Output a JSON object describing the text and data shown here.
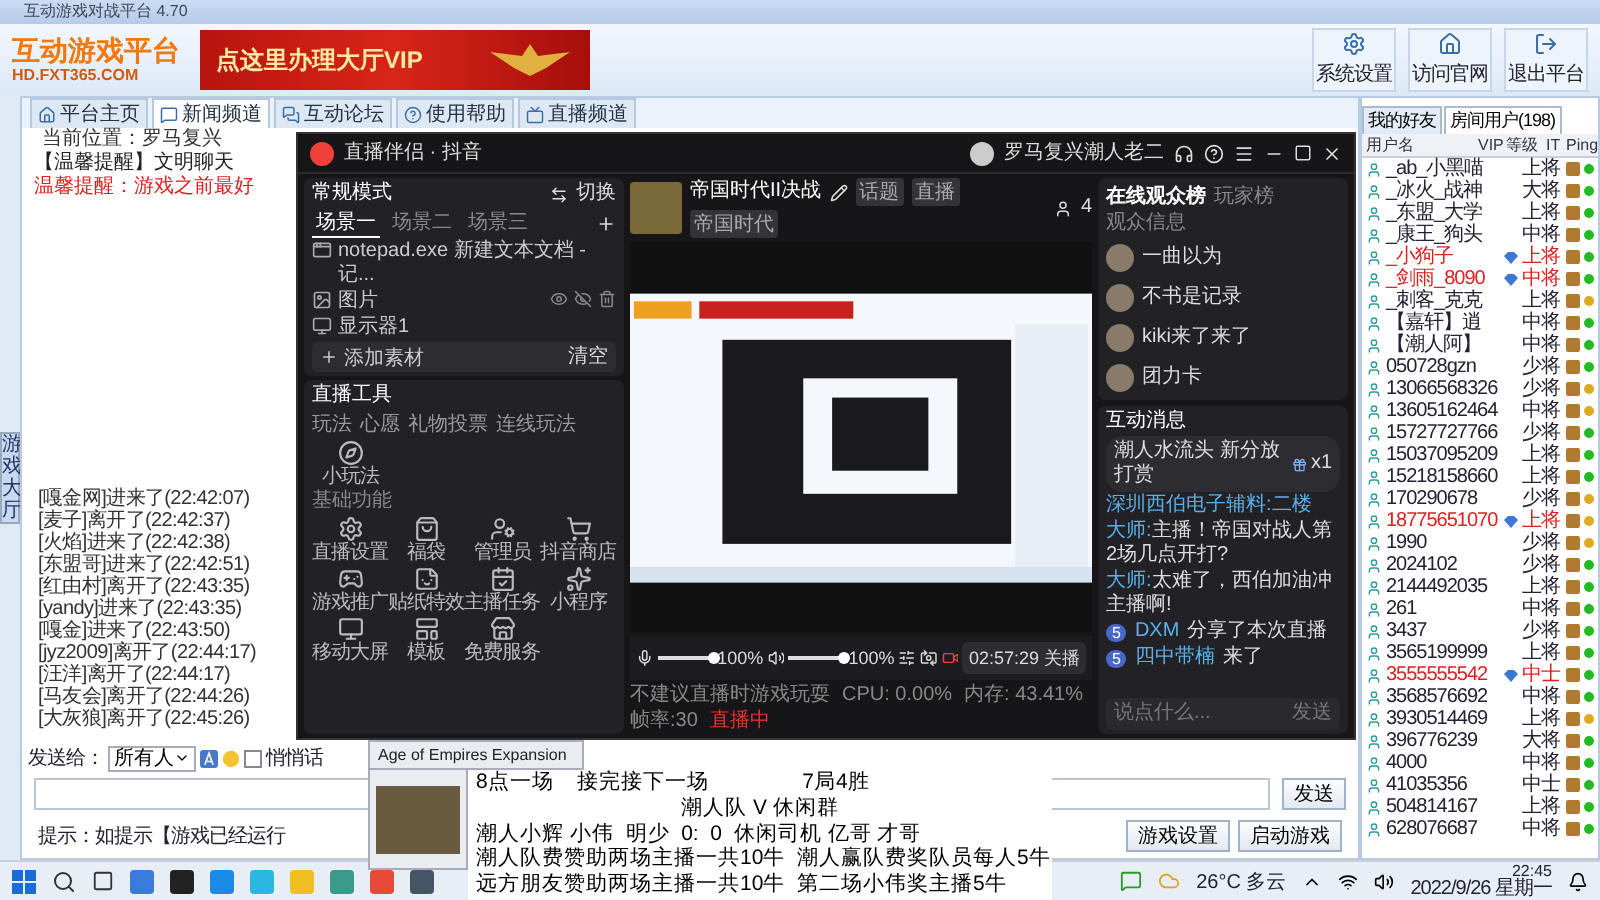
{
  "window": {
    "title": "互动游戏对战平台 4.70"
  },
  "header": {
    "logo_title": "互动游戏平台",
    "logo_url": "HD.FXT365.COM",
    "banner_text": "点这里办理大厅VIP",
    "buttons": [
      {
        "label": "系统设置"
      },
      {
        "label": "访问官网"
      },
      {
        "label": "退出平台"
      }
    ]
  },
  "nav_tabs": [
    {
      "label": "平台主页",
      "selected": false
    },
    {
      "label": "新闻频道",
      "selected": true
    },
    {
      "label": "互动论坛",
      "selected": false
    },
    {
      "label": "使用帮助",
      "selected": false
    },
    {
      "label": "直播频道",
      "selected": false
    }
  ],
  "side_tab": "游戏大厅",
  "breadcrumb": "当前位置：罗马复兴",
  "notices": [
    {
      "kind": "normal",
      "text": "【温馨提醒】文明聊天"
    },
    {
      "kind": "alert",
      "text": "温馨提醒：游戏之前最好"
    }
  ],
  "chat_log": [
    "[嘎金网]进来了(22:42:07)",
    "[麦子]离开了(22:42:37)",
    "[火焰]进来了(22:42:38)",
    "[东盟哥]进来了(22:42:51)",
    "[红由村]离开了(22:43:35)",
    "[yandy]进来了(22:43:35)",
    "[嘎金]进来了(22:43:50)",
    "[jyz2009]离开了(22:44:17)",
    "[汪洋]离开了(22:44:17)",
    "[马友会]离开了(22:44:26)",
    "[大灰狼]离开了(22:45:26)"
  ],
  "send_bar": {
    "target_label": "发送给：",
    "target_value": "所有人",
    "whisper": {
      "label": "悄悄话",
      "checked": false
    },
    "send_button": "发送",
    "hint": "提示：如提示【游戏已经运行",
    "buttons": [
      "游戏设置",
      "启动游戏"
    ]
  },
  "right_panel": {
    "tabs": [
      {
        "label": "我的好友",
        "selected": false
      },
      {
        "label": "房间用户(198)",
        "selected": true
      }
    ],
    "columns": [
      "用户名",
      "VIP",
      "等级",
      "IT",
      "Ping"
    ],
    "users": [
      {
        "name": "_ab_小黑喵",
        "level": "上将",
        "vip": false,
        "color": "#22bb22"
      },
      {
        "name": "_冰火_战神",
        "level": "大将",
        "vip": false,
        "color": "#22bb22"
      },
      {
        "name": "_东盟_大学",
        "level": "上将",
        "vip": false,
        "color": "#22bb22"
      },
      {
        "name": "_康王_狗头",
        "level": "中将",
        "vip": false,
        "color": "#22bb22"
      },
      {
        "name": "_小狗子",
        "level": "上将",
        "vip": true,
        "color": "#22bb22"
      },
      {
        "name": "_剑雨_8090",
        "level": "中将",
        "vip": true,
        "color": "#22bb22"
      },
      {
        "name": "_刺客_克克",
        "level": "上将",
        "vip": false,
        "color": "#ddaa22"
      },
      {
        "name": "【嘉轩】逍",
        "level": "中将",
        "vip": false,
        "color": "#22bb22"
      },
      {
        "name": "【潮人阿】",
        "level": "中将",
        "vip": false,
        "color": "#22bb22"
      },
      {
        "name": "050728gzn",
        "level": "少将",
        "vip": false,
        "color": "#22bb22"
      },
      {
        "name": "13066568326",
        "level": "少将",
        "vip": false,
        "color": "#ddaa22"
      },
      {
        "name": "13605162464",
        "level": "中将",
        "vip": false,
        "color": "#ddaa22"
      },
      {
        "name": "15727727766",
        "level": "少将",
        "vip": false,
        "color": "#22bb22"
      },
      {
        "name": "15037095209",
        "level": "上将",
        "vip": false,
        "color": "#22bb22"
      },
      {
        "name": "15218158660",
        "level": "上将",
        "vip": false,
        "color": "#22bb22"
      },
      {
        "name": "170290678",
        "level": "少将",
        "vip": false,
        "color": "#ddaa22"
      },
      {
        "name": "18775651070",
        "level": "上将",
        "vip": true,
        "color": "#ddaa22"
      },
      {
        "name": "1990",
        "level": "少将",
        "vip": false,
        "color": "#ddaa22"
      },
      {
        "name": "2024102",
        "level": "少将",
        "vip": false,
        "color": "#22bb22"
      },
      {
        "name": "2144492035",
        "level": "上将",
        "vip": false,
        "color": "#22bb22"
      },
      {
        "name": "261",
        "level": "中将",
        "vip": false,
        "color": "#22bb22"
      },
      {
        "name": "3437",
        "level": "少将",
        "vip": false,
        "color": "#22bb22"
      },
      {
        "name": "3565199999",
        "level": "上将",
        "vip": false,
        "color": "#22bb22"
      },
      {
        "name": "3555555542",
        "level": "中士",
        "vip": true,
        "color": "#22bb22"
      },
      {
        "name": "3568576692",
        "level": "中将",
        "vip": false,
        "color": "#22bb22"
      },
      {
        "name": "3930514469",
        "level": "上将",
        "vip": false,
        "color": "#ddaa22"
      },
      {
        "name": "396776239",
        "level": "大将",
        "vip": false,
        "color": "#22bb22"
      },
      {
        "name": "4000",
        "level": "中将",
        "vip": false,
        "color": "#22bb22"
      },
      {
        "name": "41035356",
        "level": "中士",
        "vip": false,
        "color": "#22bb22"
      },
      {
        "name": "504814167",
        "level": "上将",
        "vip": false,
        "color": "#22bb22"
      },
      {
        "name": "628076687",
        "level": "中将",
        "vip": false,
        "color": "#22bb22"
      }
    ]
  },
  "stream_app": {
    "title": "直播伴侣 · 抖音",
    "user": "罗马复兴潮人老二",
    "mode": "常规模式",
    "switch": "切换",
    "scenes": [
      {
        "label": "场景一",
        "selected": true
      },
      {
        "label": "场景二",
        "selected": false
      },
      {
        "label": "场景三",
        "selected": false
      }
    ],
    "sources": [
      {
        "kind": "window",
        "label": "notepad.exe 新建文本文档 - 记..."
      },
      {
        "kind": "image",
        "label": "图片"
      },
      {
        "kind": "display",
        "label": "显示器1"
      }
    ],
    "add_source": "添加素材",
    "clear": "清空",
    "tools_title": "直播工具",
    "tool_tabs": [
      "玩法",
      "心愿",
      "礼物投票",
      "连线玩法"
    ],
    "featured_tool": "小玩法",
    "basic_title": "基础功能",
    "basic_tools": [
      "直播设置",
      "福袋",
      "管理员",
      "抖音商店",
      "游戏推广",
      "贴纸特效",
      "主播任务",
      "小程序",
      "移动大屏",
      "模板",
      "免费服务"
    ],
    "stream_title": "帝国时代II决战",
    "stream_tags": [
      "话题",
      "直播"
    ],
    "category": "帝国时代",
    "viewer_count": "4",
    "mic": {
      "level": 1.0,
      "reading": "100%"
    },
    "speaker": {
      "level": 1.0,
      "reading": "100%"
    },
    "timer_button": "02:57:29 关播",
    "warning": "不建议直播时游戏玩耍",
    "stats": [
      "CPU: 0.00%",
      "内存: 43.41%",
      "帧率:30"
    ],
    "live_status": "直播中",
    "audience_tabs": [
      {
        "label": "在线观众榜",
        "selected": true
      },
      {
        "label": "玩家榜",
        "selected": false
      }
    ],
    "audience_header": "观众信息",
    "audience": [
      "一曲以为",
      "不书是记录",
      "kiki来了来了",
      "团力卡"
    ],
    "messages_title": "互动消息",
    "gift": {
      "text": "潮人水流头 新分放打赏",
      "count": "x1"
    },
    "messages": [
      {
        "kind": "system",
        "user": "深圳西伯电子辅料:",
        "text": "二楼"
      },
      {
        "kind": "chat",
        "user": "大师:",
        "text": "主播！帝国对战人第2场几点开打?"
      },
      {
        "kind": "chat",
        "user": "大师:",
        "text": "太难了，西伯加油冲主播啊!"
      },
      {
        "kind": "share",
        "badge": "5",
        "user": "DXM",
        "text": "分享了本次直播"
      },
      {
        "kind": "share",
        "badge": "5",
        "user": "四中带楠",
        "text": "来了"
      }
    ],
    "input_placeholder": "说点什么...",
    "send": "发送"
  },
  "thumbnail_popup": {
    "title": "Age of Empires Expansion"
  },
  "notepad": {
    "lines": [
      "8点一场    接完接下一场                7局4胜",
      "潮人队 V 休闲群",
      "潮人小辉 小伟  明少  0:  0  休闲司机 亿哥 才哥",
      "潮人队费赞助两场主播一共10牛  潮人赢队费奖队员每人5牛",
      "远方朋友赞助两场主播一共10牛  第二场小伟奖主播5牛"
    ]
  },
  "taskbar": {
    "weather": "26°C 多云",
    "time": "22:45",
    "date": "2022/9/26 星期一"
  }
}
